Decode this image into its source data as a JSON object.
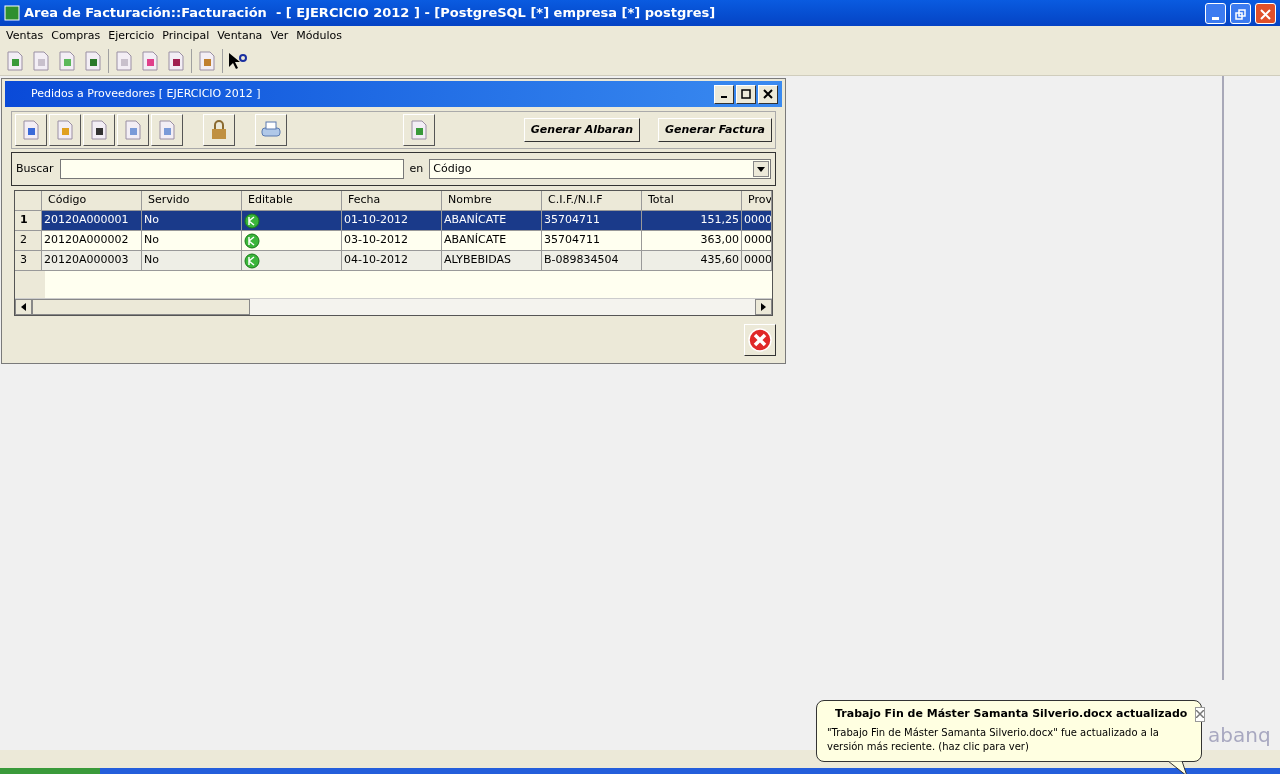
{
  "window": {
    "title": "Area de Facturación::Facturación  - [ EJERCICIO 2012 ] - [PostgreSQL [*] empresa [*] postgres]"
  },
  "menu": [
    "Ventas",
    "Compras",
    "Ejercicio",
    "Principal",
    "Ventana",
    "Ver",
    "Módulos"
  ],
  "child_window": {
    "title": "Pedidos a Proveedores [ EJERCICIO 2012 ]",
    "buttons": [
      "Generar Albaran",
      "Generar Factura"
    ],
    "search": {
      "label": "Buscar",
      "in_label": "en",
      "field": "Código"
    },
    "table": {
      "columns": [
        "Código",
        "Servido",
        "Editable",
        "Fecha",
        "Nombre",
        "C.I.F./N.I.F",
        "Total",
        "Prov"
      ],
      "rows": [
        {
          "number": "1",
          "selected": true,
          "cells": [
            "20120A000001",
            "No",
            "",
            "01-10-2012",
            "ABANÍCATE",
            "35704711",
            "151,25",
            "0000"
          ]
        },
        {
          "number": "2",
          "selected": false,
          "cells": [
            "20120A000002",
            "No",
            "",
            "03-10-2012",
            "ABANÍCATE",
            "35704711",
            "363,00",
            "0000"
          ]
        },
        {
          "number": "3",
          "selected": false,
          "cells": [
            "20120A000003",
            "No",
            "",
            "04-10-2012",
            "ALYBEBIDAS",
            "B-089834504",
            "435,60",
            "0000"
          ]
        }
      ]
    }
  },
  "logo": "abanq",
  "notification": {
    "title": "Trabajo Fin de Máster Samanta Silverio.docx actualizado",
    "body": "\"Trabajo Fin de Máster Samanta Silverio.docx\" fue actualizado a la versión más reciente. (haz clic para ver)"
  }
}
